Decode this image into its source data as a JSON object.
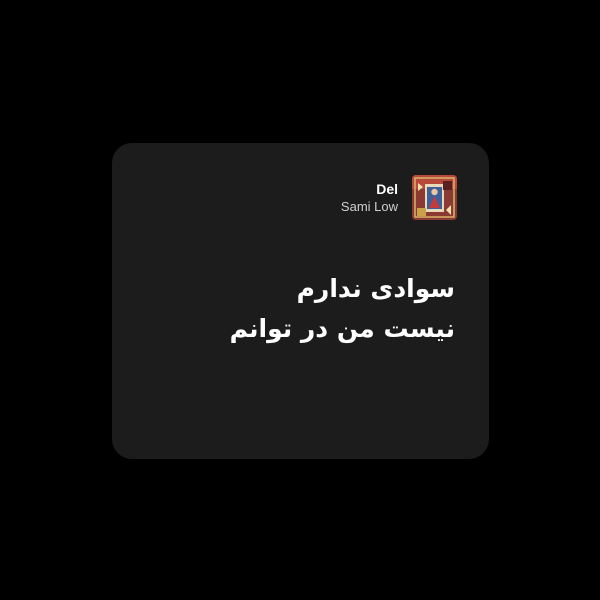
{
  "track": {
    "title": "Del",
    "artist": "Sami Low",
    "cover_icon": "album-cover"
  },
  "lyrics": {
    "lines": [
      "سوادی ندارم",
      "نیست من در توانم"
    ]
  },
  "colors": {
    "background": "#000000",
    "card": "#1c1c1c",
    "text_primary": "#ffffff",
    "text_secondary": "#cfcfcf"
  }
}
